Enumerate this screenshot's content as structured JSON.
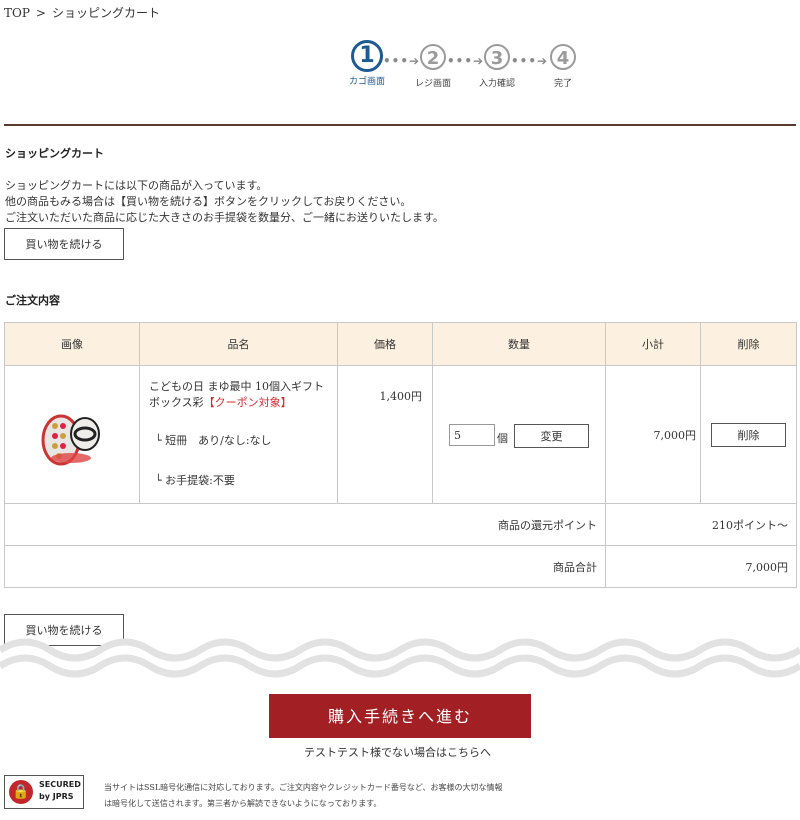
{
  "breadcrumb": {
    "home": "TOP",
    "separator": ">",
    "current": "ショッピングカート"
  },
  "steps": [
    {
      "num": "1",
      "label": "カゴ画面",
      "active": true
    },
    {
      "num": "2",
      "label": "レジ画面"
    },
    {
      "num": "3",
      "label": "入力確認"
    },
    {
      "num": "4",
      "label": "完了"
    }
  ],
  "step_arrow": "•••➔",
  "cart_title": "ショッピングカート",
  "intro": [
    "ショッピングカートには以下の商品が入っています。",
    "他の商品もみる場合は【買い物を続ける】ボタンをクリックしてお戻りください。",
    "ご注文いただいた商品に応じた大きさのお手提袋を数量分、ご一緒にお送りいたします。"
  ],
  "continue_label": "買い物を続ける",
  "order_title": "ご注文内容",
  "table": {
    "headers": [
      "画像",
      "品名",
      "価格",
      "数量",
      "小計",
      "削除"
    ],
    "item": {
      "name": "こどもの日 まゆ最中 10個入ギフトボックス彩",
      "coupon": "【クーポン対象】",
      "option1": "└ 短冊　あり/なし:なし",
      "option2": "└ お手提袋:不要",
      "price": "1,400円",
      "quantity": "5",
      "unit": "個",
      "change_label": "変更",
      "subtotal": "7,000円",
      "delete_label": "削除"
    },
    "points_label": "商品の還元ポイント",
    "points_value": "210ポイント〜",
    "total_label": "商品合計",
    "total_value": "7,000円"
  },
  "checkout_label": "購入手続きへ進む",
  "not_me_link": "テストテスト様でない場合はこちらへ",
  "security": {
    "badge_line1": "SECURED",
    "badge_line2": "by JPRS",
    "ssl_line1": "当サイトはSSL暗号化通信に対応しております。ご注文内容やクレジットカード番号など、お客様の大切な情報",
    "ssl_line2": "は暗号化して送信されます。第三者から解読できないようになっております。"
  },
  "colors": {
    "accent": "#a21f24",
    "step_active": "#1e5a94",
    "header_bg": "#fcf0e0",
    "coupon": "#d42a2a"
  }
}
